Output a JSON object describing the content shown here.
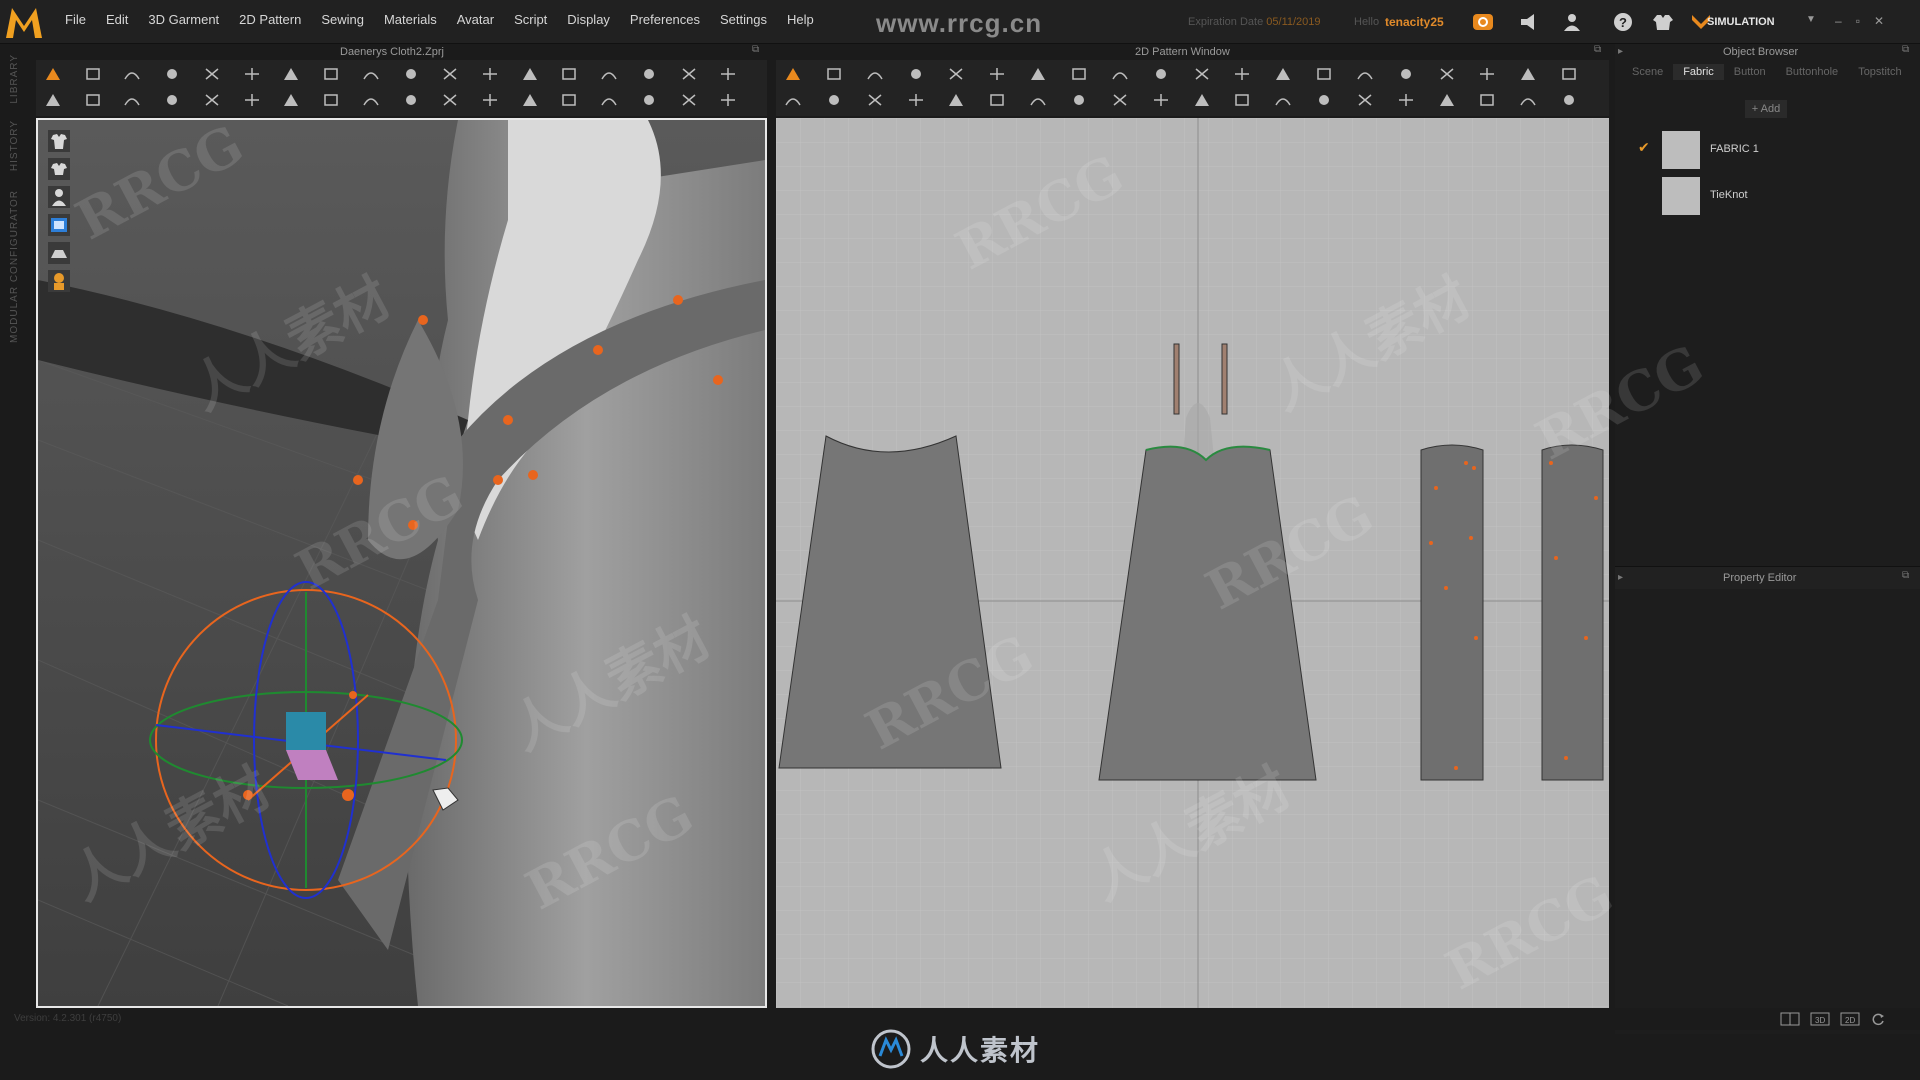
{
  "app": {
    "logo_letter": "M",
    "menus": [
      "File",
      "Edit",
      "3D Garment",
      "2D Pattern",
      "Sewing",
      "Materials",
      "Avatar",
      "Script",
      "Display",
      "Preferences",
      "Settings",
      "Help"
    ],
    "watermark_url": "www.rrcg.cn",
    "expiry_label": "Expiration Date",
    "expiry_date": "05/11/2019",
    "hello_label": "Hello",
    "username": "tenacity25",
    "mode_label": "SIMULATION",
    "window_controls": [
      "–",
      "▫",
      "✕"
    ],
    "accent_color": "#e8891e"
  },
  "left_rail": {
    "labels": [
      "LIBRARY",
      "HISTORY",
      "MODULAR CONFIGURATOR"
    ]
  },
  "view3d": {
    "title": "Daenerys Cloth2.Zprj",
    "side_tools": [
      "full-body-icon",
      "top-body-icon",
      "avatar-icon",
      "texture-icon",
      "grid-icon",
      "avatar-orange-icon"
    ]
  },
  "view2d": {
    "title": "2D Pattern Window"
  },
  "object_browser": {
    "title": "Object Browser",
    "tabs": [
      "Scene",
      "Fabric",
      "Button",
      "Buttonhole",
      "Topstitch"
    ],
    "active_tab": "Fabric",
    "add_label": "+ Add",
    "items": [
      {
        "name": "FABRIC 1",
        "checked": true
      },
      {
        "name": "TieKnot",
        "checked": false
      }
    ]
  },
  "property_editor": {
    "title": "Property Editor"
  },
  "statusbar": {
    "version": "Version: 4.2.301 (r4750)",
    "view_buttons": [
      "split-view-icon",
      "3d-view-icon",
      "2d-view-icon",
      "refresh-icon"
    ]
  },
  "bottom_watermark": {
    "text": "人人素材"
  },
  "overlay_watermarks": [
    "RRCG",
    "人人素材"
  ]
}
